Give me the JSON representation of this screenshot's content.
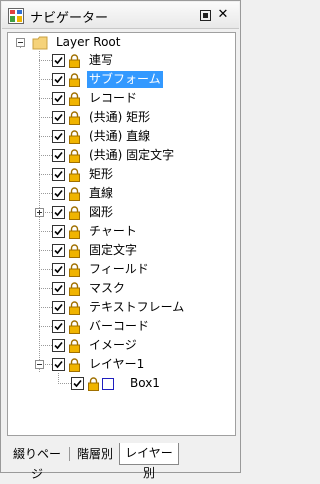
{
  "window": {
    "title": "ナビゲーター"
  },
  "tree": {
    "root": {
      "label": "Layer Root"
    },
    "items": [
      {
        "label": "連写"
      },
      {
        "label": "サブフォーム",
        "selected": true
      },
      {
        "label": "レコード"
      },
      {
        "label": "(共通) 矩形"
      },
      {
        "label": "(共通) 直線"
      },
      {
        "label": "(共通) 固定文字"
      },
      {
        "label": "矩形"
      },
      {
        "label": "直線"
      },
      {
        "label": "図形",
        "expander": "plus"
      },
      {
        "label": "チャート"
      },
      {
        "label": "固定文字"
      },
      {
        "label": "フィールド"
      },
      {
        "label": "マスク"
      },
      {
        "label": "テキストフレーム"
      },
      {
        "label": "バーコード"
      },
      {
        "label": "イメージ"
      },
      {
        "label": "レイヤー1",
        "expander": "minus"
      }
    ],
    "child": {
      "label": "Box1"
    }
  },
  "tabs": [
    {
      "label": "綴りページ"
    },
    {
      "label": "階層別"
    },
    {
      "label": "レイヤー別",
      "active": true
    }
  ],
  "colors": {
    "selection": "#3399ff",
    "box_border": "#1f1fbf",
    "lock": "#f0b400",
    "folder": "#f5d27a"
  },
  "icons": {
    "app": "navigator-icon",
    "restore": "restore-icon",
    "close": "close-icon",
    "folder": "folder-icon",
    "lock": "lock-icon",
    "check": "check-icon",
    "box": "box-shape-icon"
  }
}
